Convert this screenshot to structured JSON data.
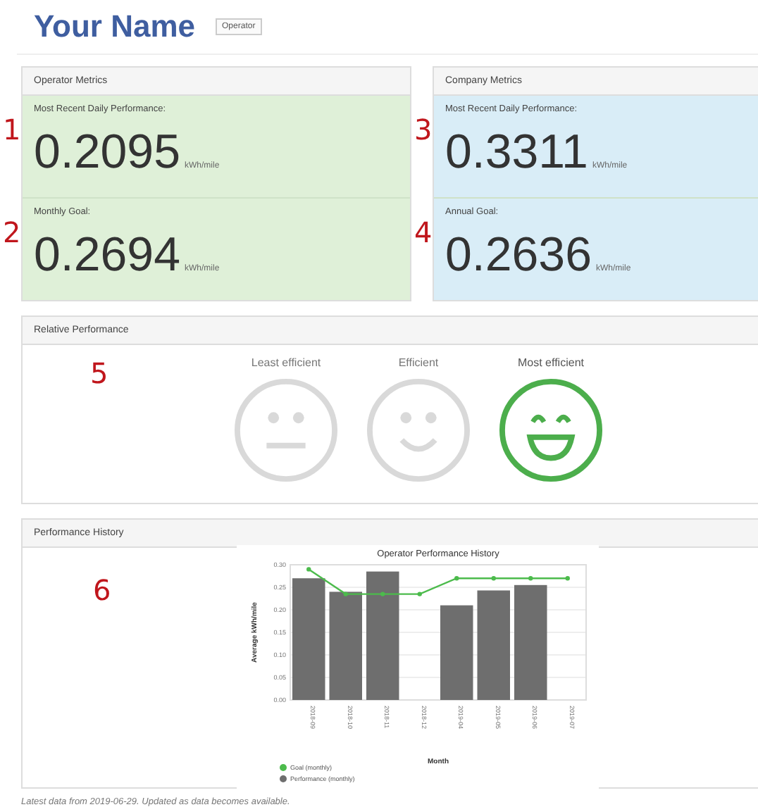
{
  "header": {
    "title": "Your Name",
    "role_badge": "Operator"
  },
  "metric_panels": [
    {
      "title": "Operator Metrics",
      "color": "#dff0d8",
      "metrics": [
        {
          "marker": "1",
          "label": "Most Recent Daily Performance:",
          "value": "0.2095",
          "unit": "kWh/mile"
        },
        {
          "marker": "2",
          "label": "Monthly Goal:",
          "value": "0.2694",
          "unit": "kWh/mile"
        }
      ]
    },
    {
      "title": "Company Metrics",
      "color": "#d9edf7",
      "metrics": [
        {
          "marker": "3",
          "label": "Most Recent Daily Performance:",
          "value": "0.3311",
          "unit": "kWh/mile"
        },
        {
          "marker": "4",
          "label": "Annual Goal:",
          "value": "0.2636",
          "unit": "kWh/mile"
        }
      ]
    }
  ],
  "relative_performance": {
    "title": "Relative Performance",
    "marker": "5",
    "levels": [
      {
        "label": "Least efficient",
        "kind": "neutral",
        "selected": false
      },
      {
        "label": "Efficient",
        "kind": "smile",
        "selected": false
      },
      {
        "label": "Most efficient",
        "kind": "grin",
        "selected": true
      }
    ]
  },
  "performance_history": {
    "title": "Performance History",
    "marker": "6",
    "chart_data": {
      "type": "bar",
      "title": "Operator Performance History",
      "xlabel": "Month",
      "ylabel": "Average kWh/mile",
      "categories": [
        "2018-09",
        "2018-10",
        "2018-11",
        "2018-12",
        "2019-04",
        "2019-05",
        "2019-06",
        "2019-07"
      ],
      "series": [
        {
          "name": "Goal (monthly)",
          "type": "line",
          "marker": "circle",
          "color": "#4cbb4c",
          "values": [
            0.29,
            0.235,
            0.235,
            0.235,
            0.27,
            0.27,
            0.27,
            0.27
          ]
        },
        {
          "name": "Performance (monthly)",
          "type": "bar",
          "color": "#6e6e6e",
          "values": [
            0.27,
            0.24,
            0.285,
            null,
            0.21,
            0.243,
            0.255,
            null
          ]
        }
      ],
      "ylim": [
        0,
        0.3
      ],
      "grid": true,
      "legend": true,
      "yticks": [
        {
          "value": 0,
          "label": "0.00"
        },
        {
          "value": 0.05,
          "label": "0.05"
        },
        {
          "value": 0.1,
          "label": "0.10"
        },
        {
          "value": 0.15,
          "label": "0.15"
        },
        {
          "value": 0.2,
          "label": "0.20"
        },
        {
          "value": 0.25,
          "label": "0.25"
        },
        {
          "value": 0.3,
          "label": "0.30"
        }
      ]
    }
  },
  "footer": "Latest data from 2019-06-29. Updated as data becomes available."
}
